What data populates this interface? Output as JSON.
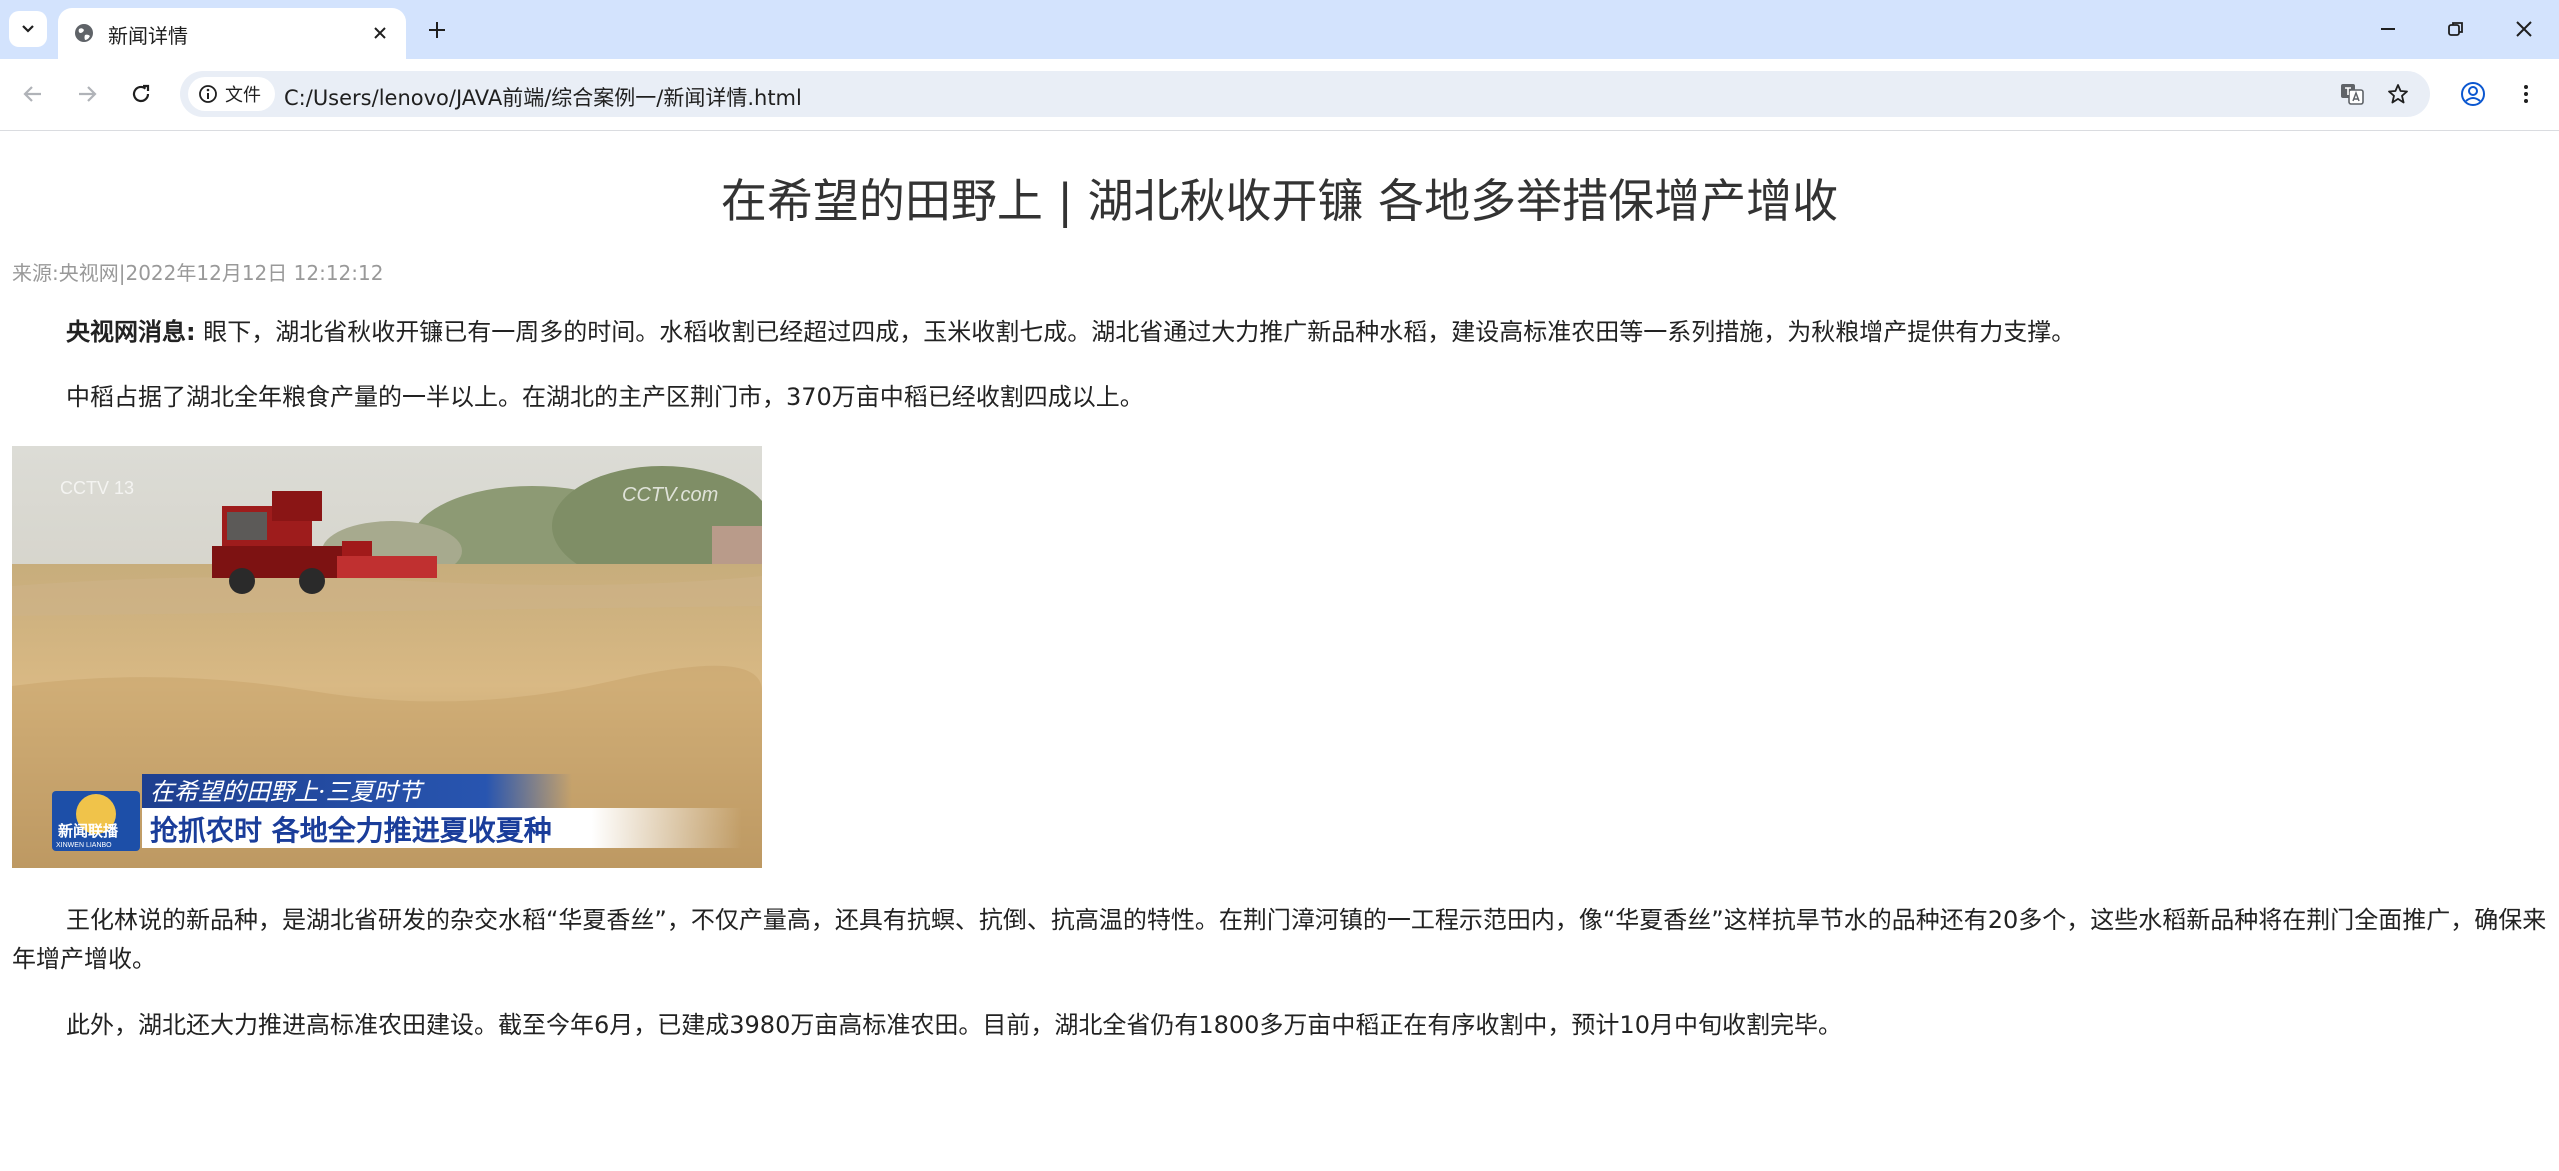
{
  "browser": {
    "tab_title": "新闻详情",
    "security_chip_label": "文件",
    "url": "C:/Users/lenovo/JAVA前端/综合案例一/新闻详情.html"
  },
  "article": {
    "title": "在希望的田野上 | 湖北秋收开镰 各地多举措保增产增收",
    "source_line": "来源:央视网|2022年12月12日 12:12:12",
    "lead_bold": "央视网消息:",
    "lead_text": " 眼下，湖北省秋收开镰已有一周多的时间。水稻收割已经超过四成，玉米收割七成。湖北省通过大力推广新品种水稻，建设高标准农田等一系列措施，为秋粮增产提供有力支撑。",
    "para2": "中稻占据了湖北全年粮食产量的一半以上。在湖北的主产区荆门市，370万亩中稻已经收割四成以上。",
    "para3": "王化林说的新品种，是湖北省研发的杂交水稻“华夏香丝”，不仅产量高，还具有抗螟、抗倒、抗高温的特性。在荆门漳河镇的一工程示范田内，像“华夏香丝”这样抗旱节水的品种还有20多个，这些水稻新品种将在荆门全面推广，确保来年增产增收。",
    "para4": "此外，湖北还大力推进高标准农田建设。截至今年6月，已建成3980万亩高标准农田。目前，湖北全省仍有1800多万亩中稻正在有序收割中，预计10月中旬收割完毕。"
  },
  "photo": {
    "caption_top": "在希望的田野上·三夏时节",
    "caption_main": "抢抓农时 各地全力推进夏收夏种",
    "logo_text": "新闻联播",
    "logo_sub": "XINWEN LIANBO",
    "channel_mark": "CCTV 13",
    "watermark": "CCTV.com"
  },
  "colors": {
    "tabstrip": "#d3e3fd",
    "omnibox": "#e9eef6",
    "title_text": "#333333",
    "source_text": "#999999"
  },
  "icons": [
    "tab-search-icon",
    "globe-icon",
    "close-icon",
    "plus-icon",
    "minimize-icon",
    "restore-icon",
    "back-icon",
    "forward-icon",
    "reload-icon",
    "info-icon",
    "translate-icon",
    "star-icon",
    "profile-icon",
    "more-icon"
  ]
}
